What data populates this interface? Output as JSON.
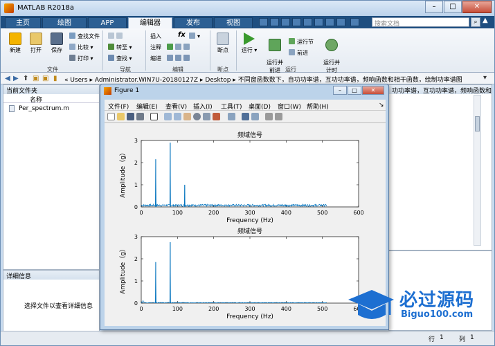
{
  "window": {
    "title": "MATLAB R2018a",
    "min": "–",
    "max": "□",
    "close": "✕"
  },
  "tabs": [
    "主页",
    "绘图",
    "APP",
    "编辑器",
    "发布",
    "视图"
  ],
  "search": {
    "placeholder": "搜索文档"
  },
  "ribbon": {
    "new": "新建",
    "open": "打开",
    "save": "保存",
    "find_files": "查找文件",
    "compare": "比较",
    "print": "打印",
    "group_file": "文件",
    "goto": "转至",
    "find": "查找",
    "group_nav": "导航",
    "insert": "插入",
    "comment": "注释",
    "indent": "缩进",
    "group_edit": "编辑",
    "breakpoint": "断点",
    "group_breakpoint": "断点",
    "run": "运行",
    "run_advance": "运行并\n前进",
    "run_section": "运行节",
    "advance": "前进",
    "run_time": "运行并\n计时",
    "group_run": "运行",
    "fx": "fx"
  },
  "address": {
    "parts": [
      "«",
      "Users",
      "Administrator.WIN7U-20180127Z",
      "Desktop",
      "不同窗函数数下，自功功率谱，互功功率谱，频响函数和相干函数，绘制功率谱图"
    ]
  },
  "current_folder": {
    "title": "当前文件夹",
    "col_name": "名称",
    "files": [
      "Per_spectrum.m"
    ]
  },
  "details": {
    "title": "详细信息",
    "message": "选择文件以查看详细信息"
  },
  "editor_tab_fragment": "功功率谱，互功功率谱，频响函数和相干函数，绘制功率谱图",
  "status": {
    "row_label": "行",
    "row": "1",
    "col_label": "列",
    "col": "1"
  },
  "figure": {
    "title": "Figure 1",
    "menu": [
      "文件(F)",
      "编辑(E)",
      "查看(V)",
      "插入(I)",
      "工具(T)",
      "桌面(D)",
      "窗口(W)",
      "帮助(H)"
    ]
  },
  "chart_data": [
    {
      "type": "line",
      "title": "频域信号",
      "xlabel": "Frequency (Hz)",
      "ylabel": "Amplitude（g）",
      "xlim": [
        0,
        600
      ],
      "ylim": [
        0,
        3
      ],
      "xticks": [
        0,
        100,
        200,
        300,
        400,
        500,
        600
      ],
      "yticks": [
        0,
        1,
        2,
        3
      ],
      "color": "#0072bd",
      "peaks": [
        {
          "x": 40,
          "y": 2.15
        },
        {
          "x": 80,
          "y": 2.9
        },
        {
          "x": 120,
          "y": 1.0
        }
      ],
      "noise_floor": 0.08,
      "x_end": 512
    },
    {
      "type": "line",
      "title": "频域信号",
      "xlabel": "Frequency (Hz)",
      "ylabel": "Amplitude（g）",
      "xlim": [
        0,
        600
      ],
      "ylim": [
        0,
        3
      ],
      "xticks": [
        0,
        100,
        200,
        300,
        400,
        500,
        600
      ],
      "yticks": [
        0,
        1,
        2,
        3
      ],
      "color": "#0072bd",
      "peaks": [
        {
          "x": 40,
          "y": 1.85
        },
        {
          "x": 80,
          "y": 2.75
        }
      ],
      "noise_floor": 0.02,
      "x_end": 512
    }
  ],
  "watermark": {
    "brand": "必过源码",
    "url": "Biguo100.com"
  }
}
